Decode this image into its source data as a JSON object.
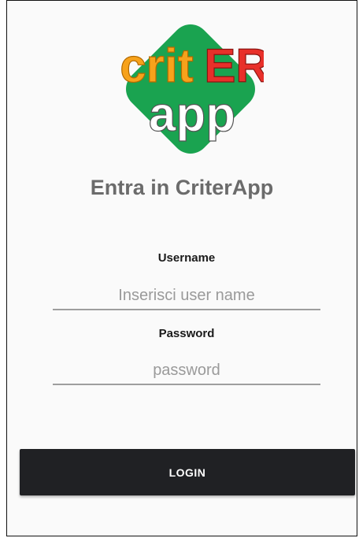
{
  "logo": {
    "word_top_left": "crit",
    "word_top_right": "ER",
    "word_bottom": "app",
    "colors": {
      "tile": "#1aa350",
      "crit": "#f7a21b",
      "er": "#e8302a",
      "app": "#ffffff"
    }
  },
  "title": "Entra in CriterApp",
  "username": {
    "label": "Username",
    "value": "",
    "placeholder": "Inserisci user name"
  },
  "password": {
    "label": "Password",
    "value": "",
    "placeholder": "password"
  },
  "login_button": {
    "label": "LOGIN",
    "color": "#202124"
  }
}
